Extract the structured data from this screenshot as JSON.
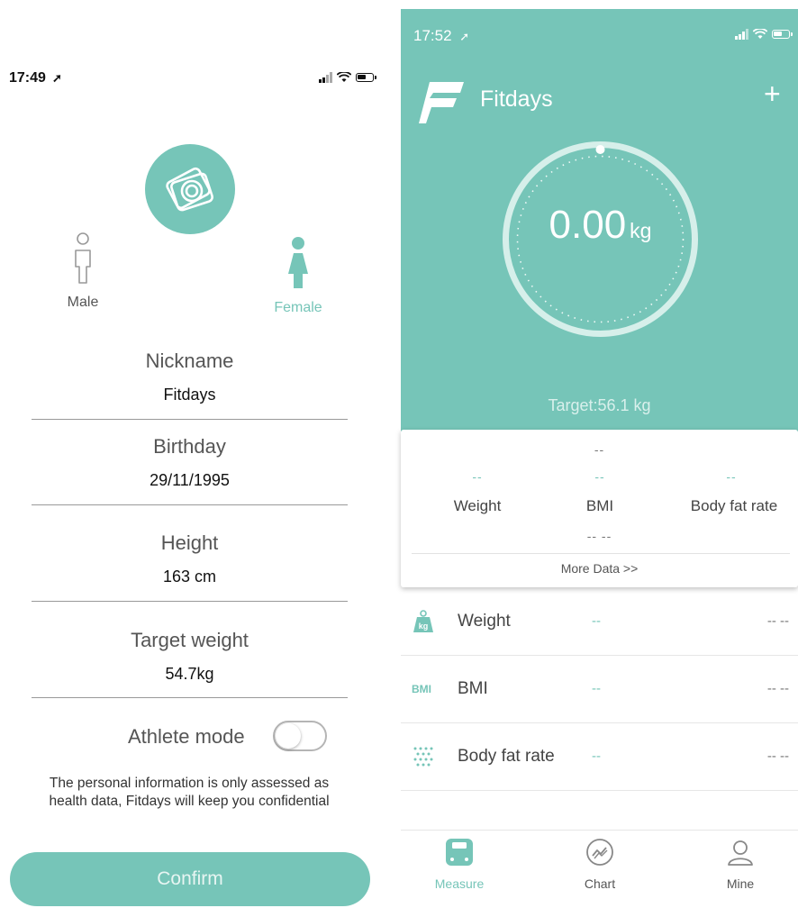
{
  "left": {
    "status": {
      "time": "17:49"
    },
    "gender": {
      "male": "Male",
      "female": "Female"
    },
    "fields": [
      {
        "label": "Nickname",
        "value": "Fitdays"
      },
      {
        "label": "Birthday",
        "value": "29/11/1995"
      },
      {
        "label": "Height",
        "value": "163 cm"
      },
      {
        "label": "Target weight",
        "value": "54.7kg"
      }
    ],
    "athlete_label": "Athlete mode",
    "athlete_on": false,
    "note_line1": "The personal information is only assessed as",
    "note_line2": "health data, Fitdays will keep you confidential",
    "confirm_label": "Confirm"
  },
  "right": {
    "status": {
      "time": "17:52"
    },
    "app_title": "Fitdays",
    "plus_icon": "+",
    "weight_value": "0.00",
    "weight_unit": "kg",
    "target": "Target:56.1 kg",
    "card": {
      "top_dash": "--",
      "weight_dash": "--",
      "bmi_dash": "--",
      "fat_dash": "--",
      "weight_label": "Weight",
      "bmi_label": "BMI",
      "fat_label": "Body fat rate",
      "bottom_dash": "-- --",
      "more": "More Data >>"
    },
    "rows": [
      {
        "icon": "kg-weight-icon",
        "name": "Weight",
        "value": "--",
        "extra": "-- --"
      },
      {
        "icon_text": "BMI",
        "name": "BMI",
        "value": "--",
        "extra": "-- --"
      },
      {
        "icon": "body-fat-icon",
        "name": "Body fat rate",
        "value": "--",
        "extra": "-- --"
      }
    ],
    "tabs": [
      {
        "label": "Measure",
        "icon": "scale-icon",
        "active": true
      },
      {
        "label": "Chart",
        "icon": "chart-icon",
        "active": false
      },
      {
        "label": "Mine",
        "icon": "person-icon",
        "active": false
      }
    ],
    "accent": "#76c5b8"
  }
}
